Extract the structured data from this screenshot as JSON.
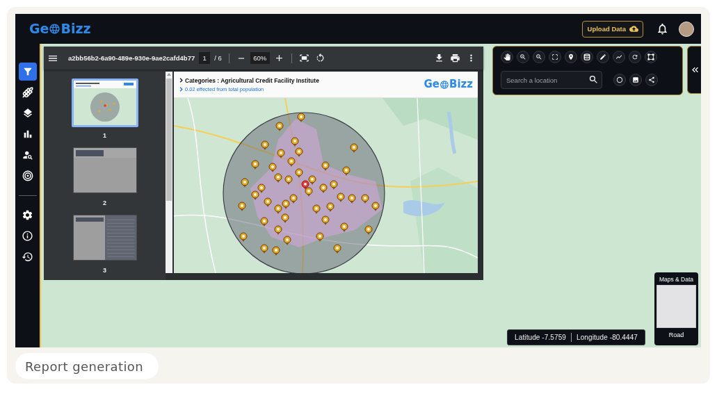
{
  "header": {
    "logo": {
      "prefix": "Ge",
      "suffix": "Bizz"
    },
    "upload_button": "Upload Data"
  },
  "sidebar": {
    "main_items": [
      {
        "selected": true
      },
      {
        "selected": false
      },
      {
        "selected": false
      },
      {
        "selected": false
      },
      {
        "selected": false
      },
      {
        "selected": false
      }
    ],
    "bottom_items": [
      {
        "selected": false
      },
      {
        "selected": false
      },
      {
        "selected": false
      }
    ]
  },
  "pdf_viewer": {
    "file_name": "a2bb56b2-6a90-489e-930e-9ae2cafd4b77",
    "current_page": "1",
    "page_total": "/ 6",
    "zoom": "60%",
    "thumbnails": [
      {
        "label": "1",
        "selected": true
      },
      {
        "label": "2",
        "selected": false
      },
      {
        "label": "3",
        "selected": false
      }
    ],
    "document_page": {
      "title": "Categories : Agricultural Credit Facility Institute",
      "subtitle": "0.02 effected from total population",
      "logo": {
        "prefix": "Ge",
        "suffix": "Bizz"
      }
    }
  },
  "map_tools": {
    "search": {
      "placeholder": "Search a location"
    }
  },
  "coordinates": {
    "latitude": "Latitude -7.5759",
    "longitude": "Longitude -80.4447"
  },
  "basemap_panel": {
    "title": "Maps & Data",
    "label": "Road"
  },
  "caption": "Report generation"
}
